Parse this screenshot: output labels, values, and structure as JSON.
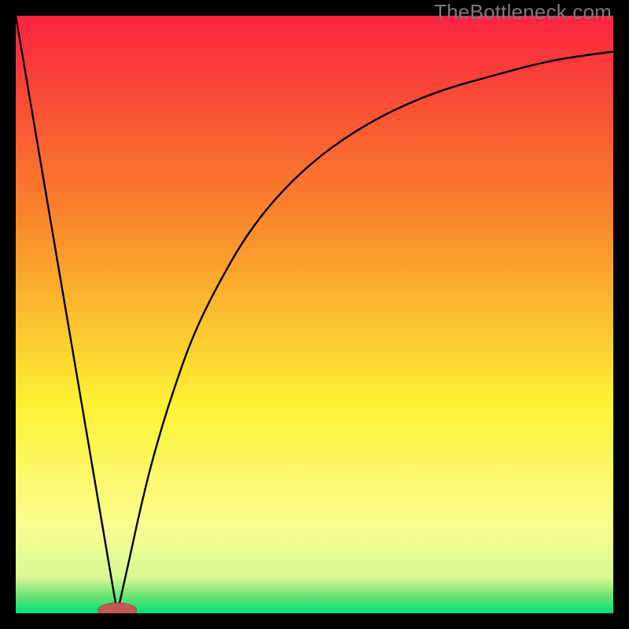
{
  "watermark": "TheBottleneck.com",
  "colors": {
    "frame": "#000000",
    "gradient_top": "#fb2340",
    "gradient_mid1": "#f98a2a",
    "gradient_mid2": "#fef133",
    "gradient_low": "#fafd8e",
    "gradient_bottom1": "#6de472",
    "gradient_bottom2": "#00e17a",
    "curve": "#000000",
    "marker_fill": "#c85a54",
    "marker_stroke": "#aa403c"
  },
  "chart_data": {
    "type": "line",
    "title": "",
    "xlabel": "",
    "ylabel": "",
    "xlim": [
      0,
      100
    ],
    "ylim": [
      0,
      100
    ],
    "series": [
      {
        "name": "left-branch",
        "x": [
          0,
          17
        ],
        "y": [
          100,
          0
        ]
      },
      {
        "name": "right-branch",
        "x": [
          17,
          19,
          21,
          23,
          26,
          30,
          35,
          40,
          46,
          53,
          61,
          70,
          80,
          90,
          100
        ],
        "y": [
          0,
          9,
          18,
          26,
          36,
          47,
          57,
          65,
          72,
          78,
          83,
          87,
          90,
          92.5,
          94
        ]
      }
    ],
    "marker": {
      "x": 17,
      "y": 0,
      "rx": 3.2,
      "ry": 1.2
    },
    "gradient_stops": [
      {
        "offset": 0,
        "color": "#fb2340"
      },
      {
        "offset": 35,
        "color": "#f98a2a"
      },
      {
        "offset": 65,
        "color": "#fef133"
      },
      {
        "offset": 85,
        "color": "#fafd8e"
      },
      {
        "offset": 94,
        "color": "#d9f896"
      },
      {
        "offset": 97,
        "color": "#6de472"
      },
      {
        "offset": 100,
        "color": "#00e17a"
      }
    ]
  }
}
